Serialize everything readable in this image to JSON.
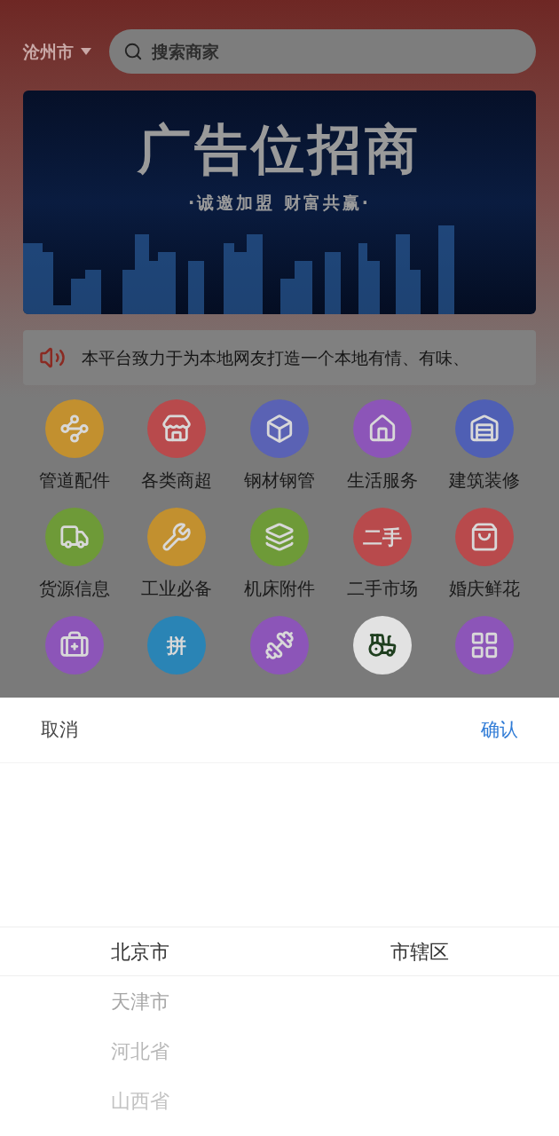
{
  "header": {
    "city": "沧州市",
    "search": {
      "placeholder": "搜索商家"
    }
  },
  "banner": {
    "title": "广告位招商",
    "subtitle": "·诚邀加盟 财富共赢·"
  },
  "notice": {
    "text": "本平台致力于为本地网友打造一个本地有情、有味、"
  },
  "categories": [
    {
      "label": "管道配件",
      "color": "#c2902f"
    },
    {
      "label": "各类商超",
      "color": "#b84a4c"
    },
    {
      "label": "钢材钢管",
      "color": "#5a62b4"
    },
    {
      "label": "生活服务",
      "color": "#8c55b8"
    },
    {
      "label": "建筑装修",
      "color": "#4f5fb4"
    },
    {
      "label": "货源信息",
      "color": "#6e9a38"
    },
    {
      "label": "工业必备",
      "color": "#c2902f"
    },
    {
      "label": "机床附件",
      "color": "#6e9a38"
    },
    {
      "label": "二手市场",
      "color": "#b84a4c",
      "icon_text": "二手"
    },
    {
      "label": "婚庆鲜花",
      "color": "#b84a4c"
    },
    {
      "color": "#8c55b8"
    },
    {
      "color": "#2a84b5",
      "icon_text": "拼"
    },
    {
      "color": "#8c55b8"
    },
    {
      "color": "#e2e2e2"
    },
    {
      "color": "#8c55b8"
    }
  ],
  "picker": {
    "cancel": "取消",
    "confirm": "确认",
    "columns": [
      {
        "items": [
          {
            "label": "北京市",
            "selected": true
          },
          {
            "label": "天津市",
            "selected": false
          },
          {
            "label": "河北省",
            "selected": false
          },
          {
            "label": "山西省",
            "selected": false
          }
        ]
      },
      {
        "items": [
          {
            "label": "市辖区",
            "selected": true
          }
        ]
      }
    ]
  }
}
